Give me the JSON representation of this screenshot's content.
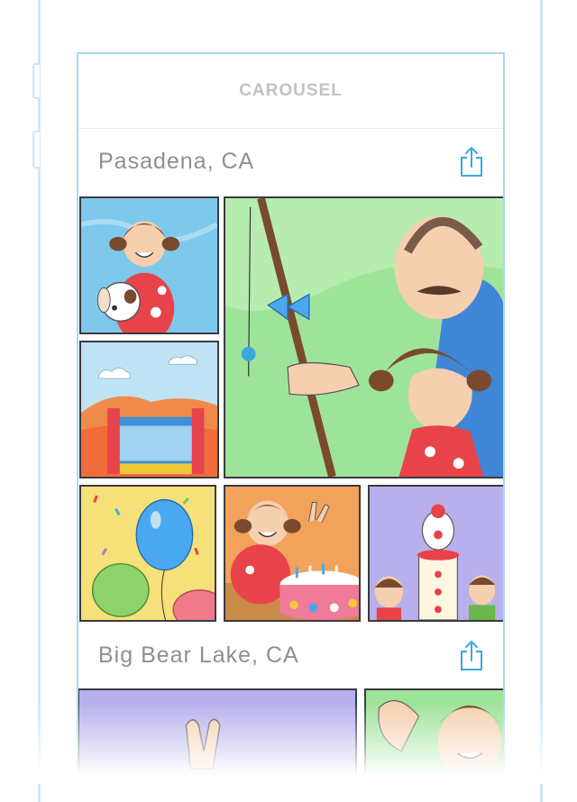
{
  "nav": {
    "title": "CAROUSEL"
  },
  "sections": [
    {
      "title": "Pasadena, CA",
      "share_icon": "share-icon"
    },
    {
      "title": "Big Bear Lake, CA",
      "share_icon": "share-icon"
    }
  ],
  "colors": {
    "accent": "#3aa8e0",
    "nav_title": "#bfc3c7",
    "section_title": "#8a9197",
    "border": "#a9d8f2"
  }
}
